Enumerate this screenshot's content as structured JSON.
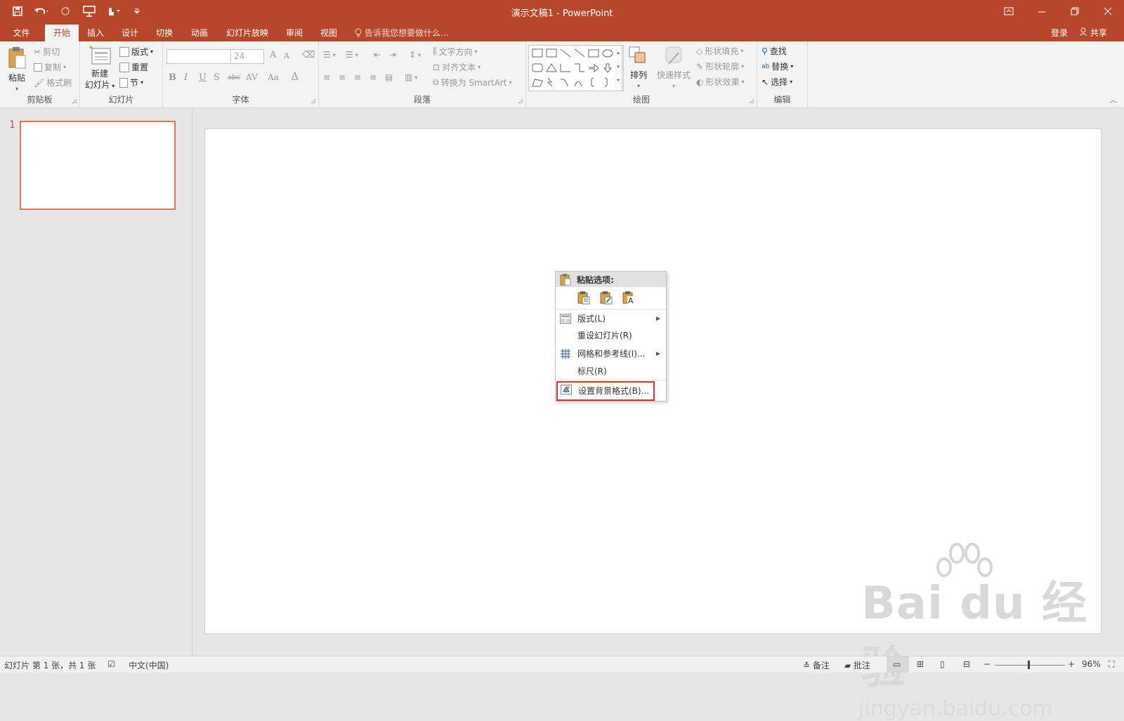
{
  "window": {
    "title": "演示文稿1 - PowerPoint"
  },
  "qat": {
    "icons": [
      "save-icon",
      "undo-icon",
      "redo-icon",
      "presenter-icon",
      "touch-mode-icon",
      "customize-icon"
    ]
  },
  "tabs": [
    "文件",
    "开始",
    "插入",
    "设计",
    "切换",
    "动画",
    "幻灯片放映",
    "审阅",
    "视图"
  ],
  "tellme": "告诉我您想要做什么...",
  "account": {
    "login": "登录",
    "share": "共享"
  },
  "ribbon": {
    "clipboard": {
      "paste": "粘贴",
      "cut": "剪切",
      "copy": "复制",
      "format_painter": "格式刷",
      "label": "剪贴板"
    },
    "slides": {
      "new_slide_1": "新建",
      "new_slide_2": "幻灯片",
      "layout": "版式",
      "reset": "重置",
      "section": "节",
      "label": "幻灯片"
    },
    "font": {
      "size": "24",
      "label": "字体",
      "bold": "B",
      "italic": "I",
      "underline": "U",
      "shadow": "S",
      "strike": "abc",
      "spacing": "AV",
      "case": "Aa",
      "color": "A",
      "grow": "A",
      "shrink": "A"
    },
    "paragraph": {
      "text_direction": "文字方向",
      "align_text": "对齐文本",
      "smartart": "转换为 SmartArt",
      "label": "段落"
    },
    "drawing": {
      "arrange": "排列",
      "quick_styles": "快速样式",
      "fill": "形状填充",
      "outline": "形状轮廓",
      "effects": "形状效果",
      "label": "绘图"
    },
    "editing": {
      "find": "查找",
      "replace": "替换",
      "select": "选择",
      "label": "编辑"
    }
  },
  "slides_pane": {
    "number": "1"
  },
  "context_menu": {
    "paste_header": "粘贴选项:",
    "items": [
      "版式(L)",
      "重设幻灯片(R)",
      "网格和参考线(I)...",
      "标尺(R)",
      "设置背景格式(B)..."
    ]
  },
  "status": {
    "slide_info": "幻灯片 第 1 张，共 1 张",
    "language": "中文(中国)",
    "notes": "备注",
    "comments": "批注",
    "zoom": "96%"
  },
  "watermark": {
    "brand": "Bai du 经验",
    "url": "jingyan.baidu.com"
  },
  "colors": {
    "accent": "#b7472a",
    "highlight": "#d0332a"
  }
}
